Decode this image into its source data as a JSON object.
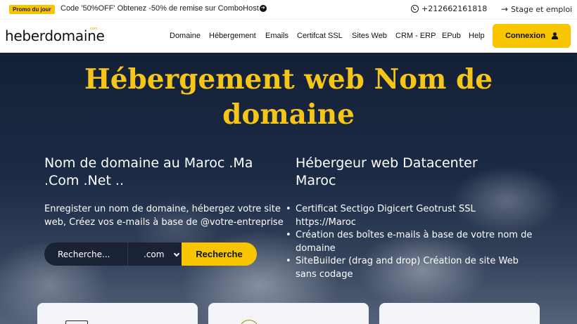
{
  "topbar": {
    "promo_badge": "Promo du jour",
    "promo_text": "Code '50%OFF' Obtenez -50% de remise sur ComboHost",
    "phone": "+212662161818",
    "stage_link": "Stage et emploi"
  },
  "navbar": {
    "logo": "heberdomaine",
    "logo_tag": "com",
    "items": [
      {
        "label": "Domaine"
      },
      {
        "label": "Hébergement"
      },
      {
        "label": "Emails"
      },
      {
        "label": "Certifcat SSL"
      },
      {
        "label": "Sites Web"
      },
      {
        "label": "CRM - ERP"
      },
      {
        "label": "EPub"
      },
      {
        "label": "Help"
      }
    ],
    "login_label": "Connexion"
  },
  "hero": {
    "title_line1": "Hébergement web Nom de",
    "title_line2": "domaine",
    "left": {
      "heading_line1": "Nom de domaine au Maroc .Ma",
      "heading_line2": ".Com .Net ..",
      "text_line1": "Enregister un nom de domaine, hébergez votre site",
      "text_line2": "web, Créez vos e-mails à base de @votre-entreprise"
    },
    "right": {
      "heading_line1": "Hébergeur web Datacenter",
      "heading_line2": "Maroc",
      "features": [
        {
          "line1": "Certificat Sectigo Digicert Geotrust SSL",
          "line2": "https://Maroc"
        },
        {
          "line1": "Création des boîtes e-mails à base de votre nom de",
          "line2": "domaine"
        },
        {
          "line1": "SiteBuilder (drag and drop) Création de site Web",
          "line2": "sans codage"
        }
      ]
    }
  },
  "search": {
    "placeholder": "Recherche...",
    "tld_selected": ".com",
    "button_label": "Recherche"
  },
  "colors": {
    "accent": "#f7c600",
    "title": "#f5c518",
    "hero_bg": "#1b2a45"
  }
}
